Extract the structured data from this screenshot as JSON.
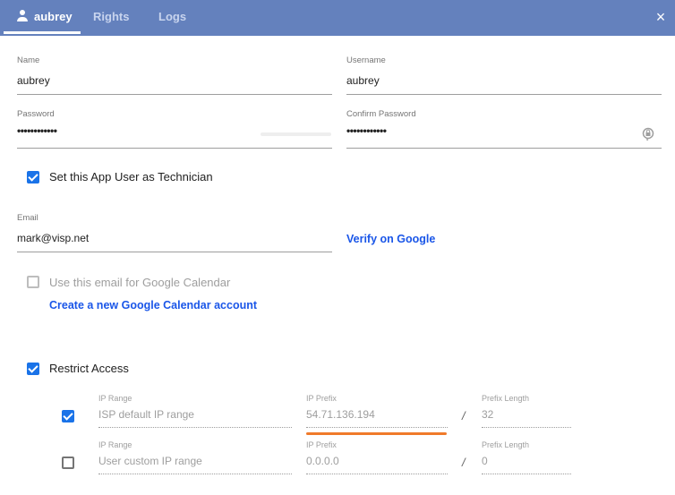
{
  "header": {
    "tabs": [
      {
        "label": "aubrey",
        "icon": "user-icon",
        "active": true
      },
      {
        "label": "Rights",
        "active": false
      },
      {
        "label": "Logs",
        "active": false
      }
    ],
    "close_icon": "×",
    "color": "#6481bd"
  },
  "form": {
    "name": {
      "label": "Name",
      "value": "aubrey"
    },
    "username": {
      "label": "Username",
      "value": "aubrey"
    },
    "password": {
      "label": "Password",
      "value": "••••••••••••"
    },
    "confirm_password": {
      "label": "Confirm Password",
      "value": "••••••••••••"
    },
    "technician": {
      "label": "Set this App User as Technician",
      "checked": true
    },
    "email": {
      "label": "Email",
      "value": "mark@visp.net"
    },
    "verify_link": "Verify on Google",
    "google_calendar": {
      "label": "Use this email for Google Calendar",
      "checked": false,
      "disabled": true
    },
    "create_calendar_link": "Create a new Google Calendar account",
    "restrict_access": {
      "label": "Restrict Access",
      "checked": true
    }
  },
  "ip_ranges": [
    {
      "checked": true,
      "range_label": "IP Range",
      "range_value": "ISP default IP range",
      "prefix_label": "IP Prefix",
      "prefix_value": "54.71.136.194",
      "separator": "/",
      "length_label": "Prefix Length",
      "length_value": "32"
    },
    {
      "checked": false,
      "range_label": "IP Range",
      "range_value": "User custom IP range",
      "prefix_label": "IP Prefix",
      "prefix_value": "0.0.0.0",
      "separator": "/",
      "length_label": "Prefix Length",
      "length_value": "0"
    }
  ],
  "colors": {
    "accent": "#1a73e8",
    "link": "#1a56e8",
    "highlight": "#f07a2a"
  }
}
